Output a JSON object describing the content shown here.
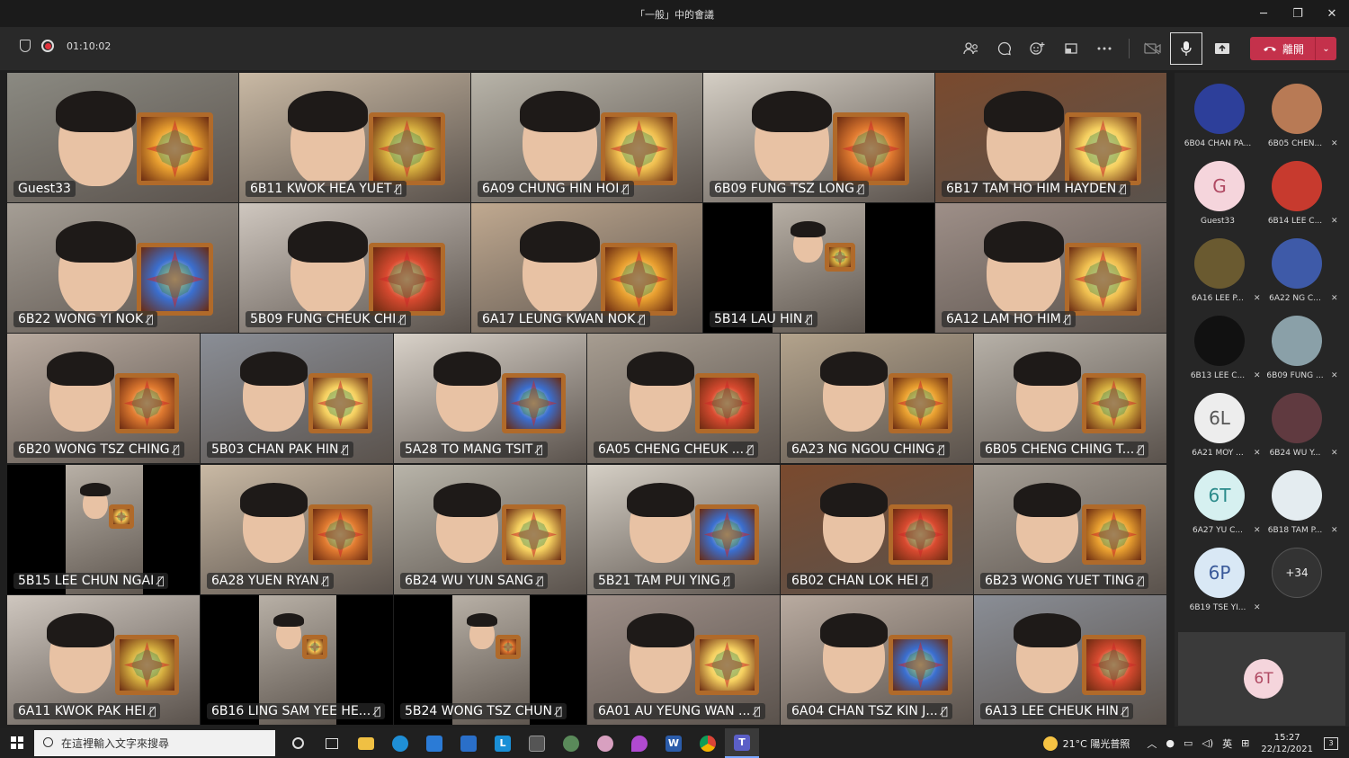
{
  "window": {
    "title": "「一般」中的會議",
    "controls": [
      "─",
      "❐",
      "✕"
    ]
  },
  "toolbar": {
    "timer": "01:10:02",
    "leave_label": "離開",
    "icons": [
      "people-icon",
      "chat-icon",
      "reactions-icon",
      "share-tray-icon",
      "more-icon"
    ]
  },
  "grid": {
    "row1": [
      {
        "name": "Guest33",
        "muted": false
      },
      {
        "name": "6B11 KWOK HEA YUET",
        "muted": true
      },
      {
        "name": "6A09 CHUNG HIN HOI",
        "muted": true
      },
      {
        "name": "6B09 FUNG TSZ LONG",
        "muted": true
      },
      {
        "name": "6B17 TAM HO HIM HAYDEN",
        "muted": true
      }
    ],
    "row2": [
      {
        "name": "6B22 WONG YI NOK",
        "muted": true
      },
      {
        "name": "5B09 FUNG CHEUK CHI",
        "muted": true
      },
      {
        "name": "6A17 LEUNG KWAN NOK",
        "muted": true
      },
      {
        "name": "5B14 LAU HIN",
        "muted": true
      },
      {
        "name": "6A12 LAM HO HIM",
        "muted": true
      }
    ],
    "row3": [
      {
        "name": "6B20 WONG TSZ CHING",
        "muted": true
      },
      {
        "name": "5B03 CHAN PAK HIN",
        "muted": true
      },
      {
        "name": "5A28 TO MANG TSIT",
        "muted": true
      },
      {
        "name": "6A05 CHENG CHEUK ...",
        "muted": true
      },
      {
        "name": "6A23 NG NGOU CHING",
        "muted": true
      },
      {
        "name": "6B05 CHENG CHING T...",
        "muted": true
      }
    ],
    "row4": [
      {
        "name": "5B15 LEE CHUN NGAI",
        "muted": true
      },
      {
        "name": "6A28 YUEN RYAN",
        "muted": true
      },
      {
        "name": "6B24 WU YUN SANG",
        "muted": true
      },
      {
        "name": "5B21 TAM PUI YING",
        "muted": true
      },
      {
        "name": "6B02 CHAN LOK HEI",
        "muted": true
      },
      {
        "name": "6B23 WONG YUET TING",
        "muted": true
      }
    ],
    "row5": [
      {
        "name": "6A11 KWOK PAK HEI",
        "muted": true
      },
      {
        "name": "6B16 LING SAM YEE HE...",
        "muted": true
      },
      {
        "name": "5B24 WONG TSZ CHUN",
        "muted": true
      },
      {
        "name": "6A01 AU YEUNG WAN ...",
        "muted": true
      },
      {
        "name": "6A04 CHAN TSZ KIN J...",
        "muted": true
      },
      {
        "name": "6A13 LEE CHEUK HIN",
        "muted": true
      }
    ],
    "mute_glyph": "🎙̸"
  },
  "panel": {
    "participants": [
      {
        "name": "6B04 CHAN PA...",
        "avatar": "",
        "muted": false
      },
      {
        "name": "6B05 CHEN...",
        "avatar": "",
        "muted": true
      },
      {
        "name": "Guest33",
        "avatar": "G",
        "muted": false
      },
      {
        "name": "6B14 LEE C...",
        "avatar": "",
        "muted": true
      },
      {
        "name": "6A16 LEE P...",
        "avatar": "",
        "muted": true
      },
      {
        "name": "6A22 NG C...",
        "avatar": "",
        "muted": true
      },
      {
        "name": "6B13 LEE C...",
        "avatar": "",
        "muted": true
      },
      {
        "name": "6B09 FUNG ...",
        "avatar": "",
        "muted": true
      },
      {
        "name": "6A21 MOY ...",
        "avatar": "6L",
        "muted": true
      },
      {
        "name": "6B24 WU Y...",
        "avatar": "",
        "muted": true
      },
      {
        "name": "6A27 YU C...",
        "avatar": "6T",
        "muted": true
      },
      {
        "name": "6B18 TAM P...",
        "avatar": "",
        "muted": true
      },
      {
        "name": "6B19 TSE YI...",
        "avatar": "6P",
        "muted": true
      }
    ],
    "more_count": "+34",
    "self_avatar": "6T",
    "mute_glyph": "✕"
  },
  "taskbar": {
    "search_placeholder": "在這裡輸入文字來搜尋",
    "weather": "21°C 陽光普照",
    "ime": "英",
    "time": "15:27",
    "date": "22/12/2021",
    "notif_count": "3"
  }
}
